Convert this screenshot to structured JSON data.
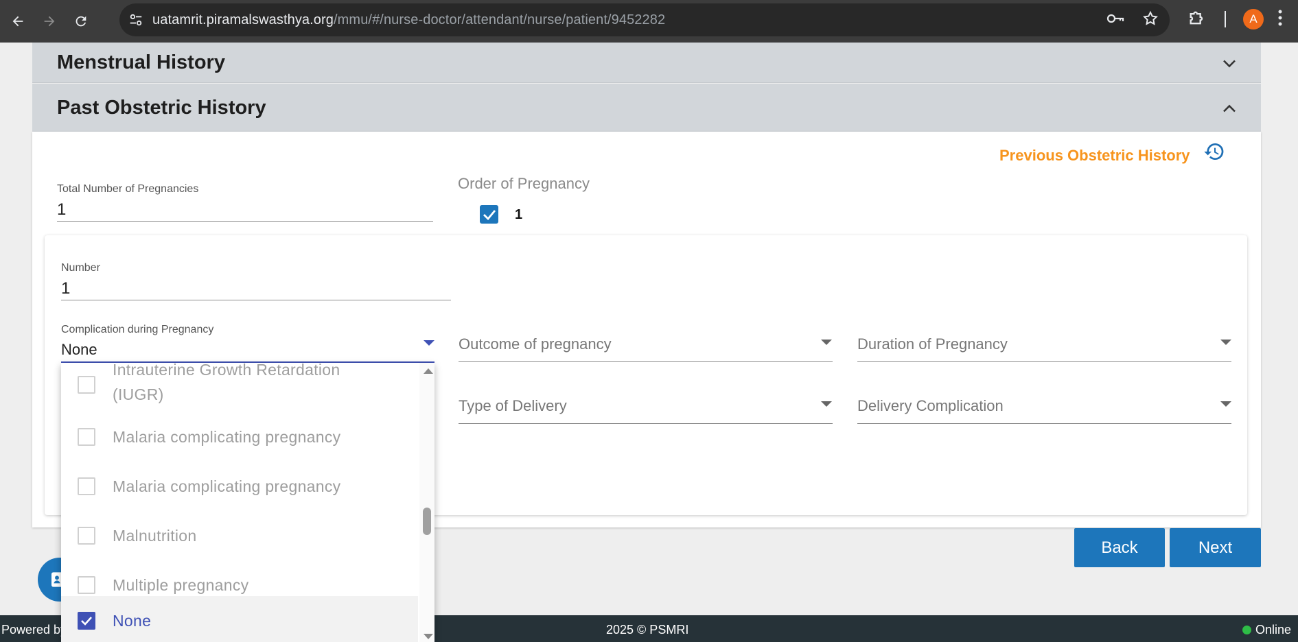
{
  "browser": {
    "url_host": "uatamrit.piramalswasthya.org",
    "url_path": "/mmu/#/nurse-doctor/attendant/nurse/patient/9452282",
    "profile_initial": "A"
  },
  "accordion": {
    "menstrual_title": "Menstrual History",
    "obstetric_title": "Past Obstetric History"
  },
  "panel": {
    "previous_history_link": "Previous Obstetric History",
    "total_pregnancies_label": "Total Number of Pregnancies",
    "total_pregnancies_value": "1",
    "order_label": "Order of Pregnancy",
    "order_options": [
      "1"
    ]
  },
  "card": {
    "number_label": "Number",
    "number_value": "1",
    "complication_label": "Complication during Pregnancy",
    "complication_value": "None",
    "outcome_placeholder": "Outcome of pregnancy",
    "duration_placeholder": "Duration of Pregnancy",
    "delivery_type_placeholder": "Type of Delivery",
    "delivery_complication_placeholder": "Delivery Complication"
  },
  "dropdown": {
    "options": [
      {
        "label_line1": "Intrauterine Growth Retardation",
        "label_line2": "(IUGR)",
        "checked": false
      },
      {
        "label": "Malaria complicating pregnancy",
        "checked": false
      },
      {
        "label": "Malaria complicating pregnancy",
        "checked": false
      },
      {
        "label": "Malnutrition",
        "checked": false
      },
      {
        "label": "Multiple pregnancy",
        "checked": false
      },
      {
        "label": "None",
        "checked": true
      }
    ]
  },
  "buttons": {
    "back": "Back",
    "next": "Next"
  },
  "footer": {
    "powered": "Powered by",
    "copyright": "2025 © PSMRI",
    "status": "Online"
  },
  "colors": {
    "primary": "#1d76bb",
    "accent_link": "#f7941d",
    "selected_option": "#3f51b5",
    "footer_bg": "#263238",
    "online": "#2ebd47"
  }
}
